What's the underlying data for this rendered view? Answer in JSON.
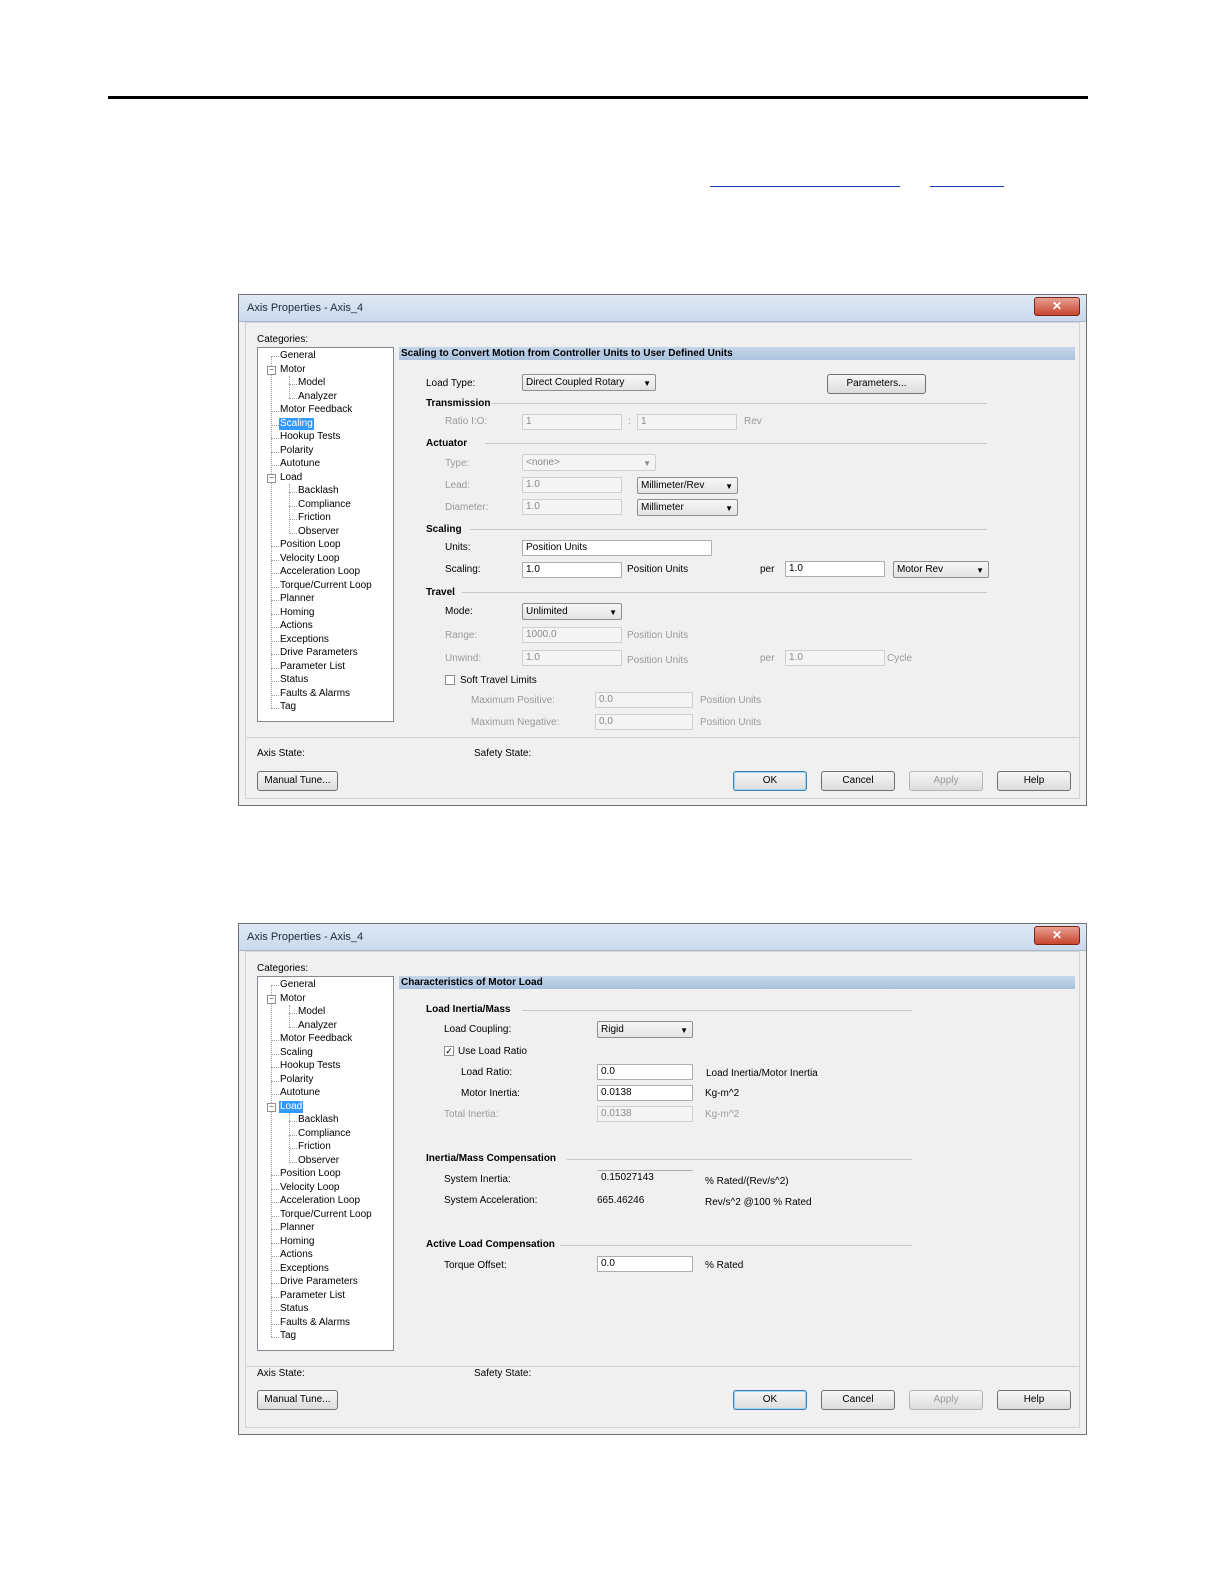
{
  "dialog1": {
    "title": "Axis Properties - Axis_4",
    "categories_label": "Categories:",
    "tree": [
      "General",
      "Motor",
      "Model",
      "Analyzer",
      "Motor Feedback",
      "Scaling",
      "Hookup Tests",
      "Polarity",
      "Autotune",
      "Load",
      "Backlash",
      "Compliance",
      "Friction",
      "Observer",
      "Position Loop",
      "Velocity Loop",
      "Acceleration Loop",
      "Torque/Current Loop",
      "Planner",
      "Homing",
      "Actions",
      "Exceptions",
      "Drive Parameters",
      "Parameter List",
      "Status",
      "Faults & Alarms",
      "Tag"
    ],
    "selected": "Scaling",
    "header": "Scaling to Convert Motion from Controller Units to User Defined Units",
    "load_type_label": "Load Type:",
    "load_type_value": "Direct Coupled Rotary",
    "parameters_button": "Parameters...",
    "transmission_label": "Transmission",
    "ratio_label": "Ratio I:O:",
    "ratio_in": "1",
    "ratio_colon": ":",
    "ratio_out": "1",
    "ratio_unit": "Rev",
    "actuator_label": "Actuator",
    "type_label": "Type:",
    "type_value": "<none>",
    "lead_label": "Lead:",
    "lead_value": "1.0",
    "lead_unit": "Millimeter/Rev",
    "diameter_label": "Diameter:",
    "diameter_value": "1.0",
    "diameter_unit": "Millimeter",
    "scaling_section": "Scaling",
    "units_label": "Units:",
    "units_value": "Position Units",
    "scaling_label": "Scaling:",
    "scaling_value": "1.0",
    "scaling_unit": "Position Units",
    "per_label": "per",
    "per_value": "1.0",
    "per_unit": "Motor Rev",
    "travel_label": "Travel",
    "mode_label": "Mode:",
    "mode_value": "Unlimited",
    "range_label": "Range:",
    "range_value": "1000.0",
    "range_unit": "Position Units",
    "unwind_label": "Unwind:",
    "unwind_value": "1.0",
    "unwind_unit": "Position Units",
    "unwind_per_label": "per",
    "unwind_per_value": "1.0",
    "unwind_per_unit": "Cycle",
    "soft_travel_label": "Soft Travel Limits",
    "max_pos_label": "Maximum Positive:",
    "max_pos_value": "0.0",
    "max_pos_unit": "Position Units",
    "max_neg_label": "Maximum Negative:",
    "max_neg_value": "0.0",
    "max_neg_unit": "Position Units",
    "axis_state_label": "Axis State:",
    "safety_state_label": "Safety State:",
    "manual_tune": "Manual Tune...",
    "ok": "OK",
    "cancel": "Cancel",
    "apply": "Apply",
    "help": "Help"
  },
  "dialog2": {
    "title": "Axis Properties - Axis_4",
    "categories_label": "Categories:",
    "selected": "Load",
    "header": "Characteristics of Motor Load",
    "load_inertia_section": "Load Inertia/Mass",
    "load_coupling_label": "Load Coupling:",
    "load_coupling_value": "Rigid",
    "use_load_ratio_label": "Use Load Ratio",
    "load_ratio_label": "Load Ratio:",
    "load_ratio_value": "0.0",
    "load_ratio_unit": "Load Inertia/Motor Inertia",
    "motor_inertia_label": "Motor Inertia:",
    "motor_inertia_value": "0.0138",
    "motor_inertia_unit": "Kg-m^2",
    "total_inertia_label": "Total Inertia:",
    "total_inertia_value": "0.0138",
    "total_inertia_unit": "Kg-m^2",
    "comp_section": "Inertia/Mass Compensation",
    "system_inertia_label": "System Inertia:",
    "system_inertia_value": "0.15027143",
    "system_inertia_unit": "% Rated/(Rev/s^2)",
    "system_accel_label": "System Acceleration:",
    "system_accel_value": "665.46246",
    "system_accel_unit": "Rev/s^2 @100 % Rated",
    "active_load_section": "Active Load Compensation",
    "torque_offset_label": "Torque Offset:",
    "torque_offset_value": "0.0",
    "torque_offset_unit": "% Rated",
    "axis_state_label": "Axis State:",
    "safety_state_label": "Safety State:",
    "manual_tune": "Manual Tune...",
    "ok": "OK",
    "cancel": "Cancel",
    "apply": "Apply",
    "help": "Help"
  }
}
